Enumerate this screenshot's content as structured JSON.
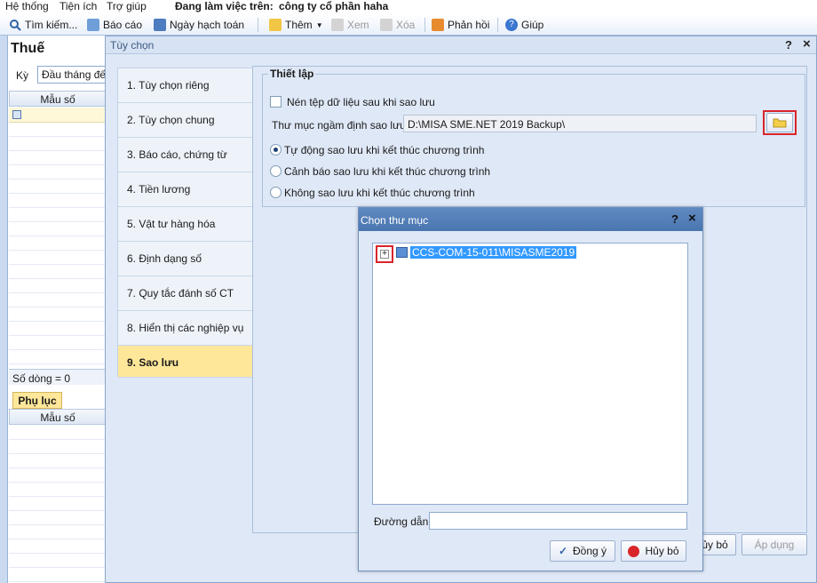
{
  "menu": {
    "items": [
      "Hệ thống",
      "Tiện ích",
      "Trợ giúp"
    ],
    "working_label": "Đang làm việc trên:",
    "company": "công ty cổ phần haha"
  },
  "toolbar": {
    "search": "Tìm kiếm...",
    "report": "Báo cáo",
    "posting_date": "Ngày hạch toán",
    "add": "Thêm",
    "view": "Xem",
    "delete": "Xóa",
    "feedback": "Phản hồi",
    "help": "Giúp"
  },
  "left": {
    "title": "Thuế",
    "period_label": "Kỳ",
    "period_value": "Đầu tháng đến",
    "col_form": "Mẫu số",
    "row_count": "Số dòng = 0",
    "appendix_tab": "Phụ lục",
    "col_form2": "Mẫu số"
  },
  "dialog": {
    "title": "Tùy chọn",
    "help": "?",
    "close": "×",
    "tabs": [
      {
        "label": "1. Tùy chọn riêng"
      },
      {
        "label": "2. Tùy chọn chung"
      },
      {
        "label": "3. Báo cáo, chứng từ"
      },
      {
        "label": "4. Tiền lương"
      },
      {
        "label": "5. Vật tư hàng hóa"
      },
      {
        "label": "6. Định dạng số"
      },
      {
        "label": "7. Quy tắc đánh số CT"
      },
      {
        "label": "8. Hiển thị các nghiệp vụ"
      },
      {
        "label": "9. Sao lưu"
      }
    ],
    "active_tab": 8,
    "group_title": "Thiết lập",
    "compress_label": "Nén tệp dữ liệu sau khi sao lưu",
    "folder_label": "Thư mục ngầm định sao lưu",
    "folder_value": "D:\\MISA SME.NET 2019 Backup\\",
    "radio_auto": "Tự động sao lưu khi kết thúc chương trình",
    "radio_warn": "Cảnh báo sao lưu khi kết thúc chương trình",
    "radio_none": "Không sao lưu khi kết thúc chương trình",
    "cancel_partial": "ủy bỏ",
    "apply": "Áp dụng"
  },
  "folder_dialog": {
    "title": "Chọn thư mục",
    "help": "?",
    "close": "×",
    "tree_root": "CCS-COM-15-011\\MISASME2019",
    "path_label": "Đường dẫn",
    "path_value": "",
    "ok": "Đồng ý",
    "cancel": "Hủy bỏ"
  },
  "colors": {
    "accent": "#3399ff",
    "highlight_red": "#d9252a",
    "active_tab": "#ffe79a",
    "title_blue": "#4a76b0"
  }
}
